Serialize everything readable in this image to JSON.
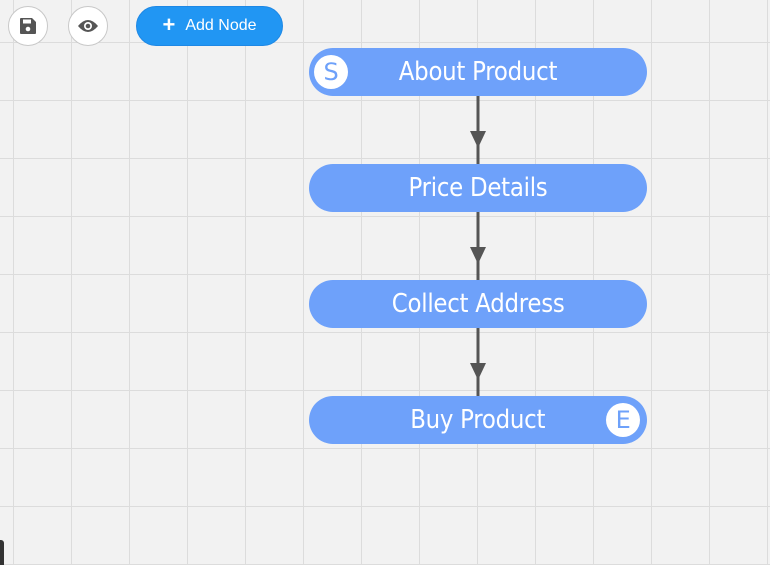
{
  "toolbar": {
    "save_icon": "floppy-disk-icon",
    "preview_icon": "eye-icon",
    "add_node_label": "Add Node",
    "add_icon": "plus-icon",
    "accent_color": "#2196f3"
  },
  "flow": {
    "node_color": "#6ea1fa",
    "nodes": [
      {
        "label": "About Product",
        "badge": "S"
      },
      {
        "label": "Price Details",
        "badge": ""
      },
      {
        "label": "Collect Address",
        "badge": ""
      },
      {
        "label": "Buy Product",
        "badge": "E"
      }
    ],
    "edges": [
      {
        "from": "About Product",
        "to": "Price Details"
      },
      {
        "from": "Price Details",
        "to": "Collect Address"
      },
      {
        "from": "Collect Address",
        "to": "Buy Product"
      }
    ]
  }
}
